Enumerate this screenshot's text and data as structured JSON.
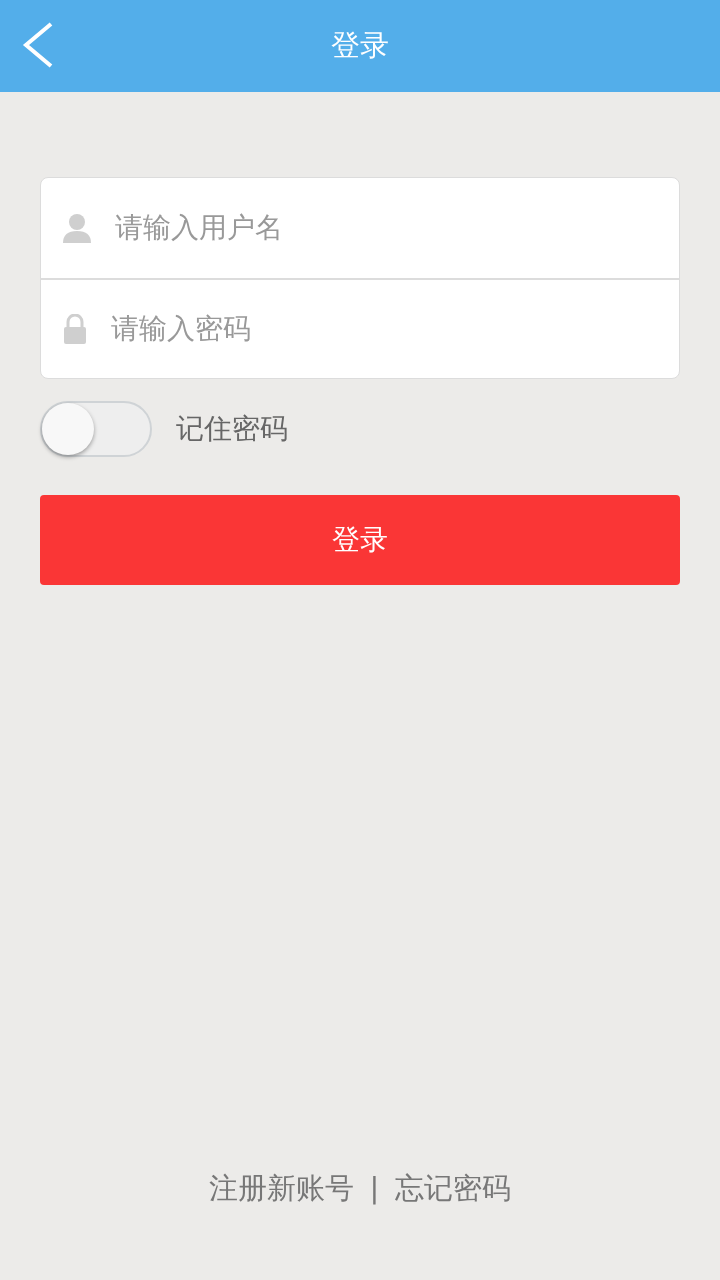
{
  "header": {
    "title": "登录"
  },
  "fields": [
    {
      "kind": "user",
      "placeholder": "请输入用户名"
    },
    {
      "kind": "lock",
      "placeholder": "请输入密码"
    }
  ],
  "remember": {
    "label": "记住密码",
    "on": false
  },
  "login_button": {
    "label": "登录"
  },
  "footer": {
    "register": "注册新账号",
    "separator": "|",
    "forgot": "忘记密码"
  }
}
